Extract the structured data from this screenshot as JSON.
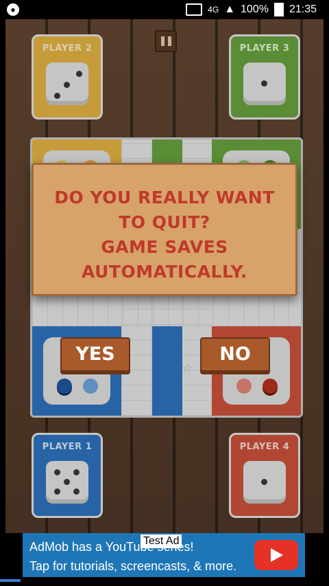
{
  "status": {
    "battery": "100%",
    "time": "21:35",
    "network": "4G"
  },
  "players": {
    "p1": {
      "label": "PLAYER 1",
      "die": 5
    },
    "p2": {
      "label": "PLAYER 2",
      "die": 3
    },
    "p3": {
      "label": "PLAYER 3",
      "die": 1
    },
    "p4": {
      "label": "PLAYER 4",
      "die": 1
    }
  },
  "dialog": {
    "line1": "DO YOU REALLY WANT",
    "line2": "TO QUIT?",
    "line3": "GAME SAVES",
    "line4": "AUTOMATICALLY.",
    "yes": "YES",
    "no": "NO"
  },
  "ad": {
    "tag": "Test Ad",
    "line1": "AdMob has a YouTube series!",
    "line2": "Tap for tutorials, screencasts, & more."
  },
  "colors": {
    "yellow": "#e9b845",
    "green": "#6aa63f",
    "blue": "#2f76c2",
    "red": "#d0533c"
  }
}
